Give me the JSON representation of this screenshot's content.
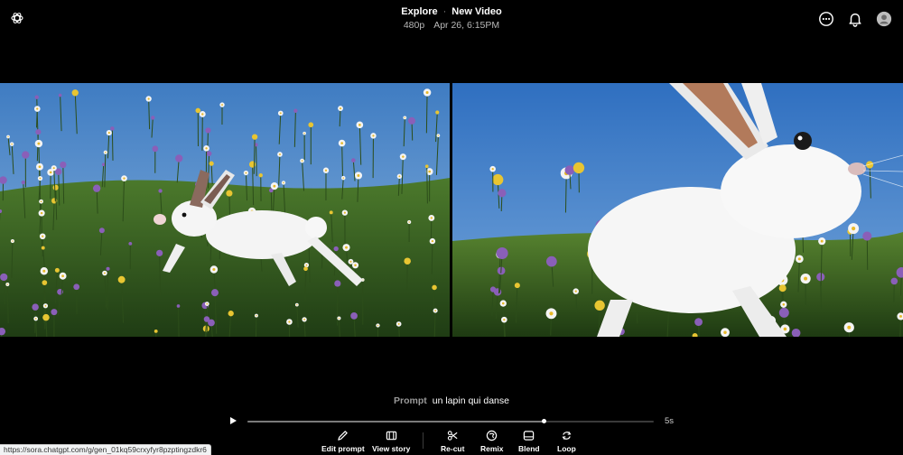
{
  "header": {
    "breadcrumb_parent": "Explore",
    "separator": "·",
    "page_title": "New Video",
    "resolution": "480p",
    "timestamp": "Apr 26, 6:15PM",
    "icons": [
      "openai-logo-icon",
      "more-options-icon",
      "notifications-bell-icon",
      "profile-avatar-icon"
    ]
  },
  "video": {
    "left_scene": "white rabbit leaping through meadow of daisies and purple flowers",
    "right_scene": "close-up of white rabbit with tall ears among daisies under blue sky"
  },
  "prompt": {
    "label": "Prompt",
    "text": "un lapin qui danse"
  },
  "player": {
    "progress": 0.73,
    "duration": "5s",
    "play_icon": "play-icon"
  },
  "toolbar": {
    "items": [
      {
        "label": "Edit prompt",
        "icon": "pencil-icon"
      },
      {
        "label": "View story",
        "icon": "storyboard-icon"
      },
      {
        "label": "Re-cut",
        "icon": "scissors-icon"
      },
      {
        "label": "Remix",
        "icon": "remix-icon"
      },
      {
        "label": "Blend",
        "icon": "blend-icon"
      },
      {
        "label": "Loop",
        "icon": "loop-icon"
      }
    ]
  },
  "status_url": "https://sora.chatgpt.com/g/gen_01kq59crxyfyr8pzptingzdkr6",
  "colors": {
    "background": "#000000",
    "sky": "#4a86c9",
    "grass": "#2f5b1f",
    "accent_text": "#ffffff"
  }
}
